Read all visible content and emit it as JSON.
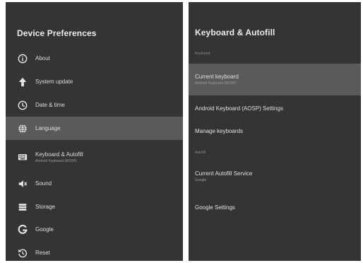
{
  "left": {
    "title": "Device Preferences",
    "items": [
      {
        "label": "About",
        "sub": "",
        "icon": "info-icon"
      },
      {
        "label": "System update",
        "sub": "",
        "icon": "arrow-up-icon"
      },
      {
        "label": "Date & time",
        "sub": "",
        "icon": "clock-icon"
      },
      {
        "label": "Language",
        "sub": "",
        "icon": "globe-icon",
        "selected": true
      },
      {
        "label": "Keyboard & Autofill",
        "sub": "Android Keyboard (AOSP)",
        "icon": "keyboard-icon"
      },
      {
        "label": "Sound",
        "sub": "",
        "icon": "speaker-icon"
      },
      {
        "label": "Storage",
        "sub": "",
        "icon": "storage-icon"
      },
      {
        "label": "Google",
        "sub": "",
        "icon": "google-icon"
      },
      {
        "label": "Reset",
        "sub": "",
        "icon": "reset-icon"
      }
    ]
  },
  "right": {
    "title": "Keyboard & Autofill",
    "section_keyboard": "Keyboard",
    "current_keyboard": {
      "label": "Current keyboard",
      "sub": "Android Keyboard (AOSP)"
    },
    "aosp_settings": {
      "label": "Android Keyboard (AOSP) Settings"
    },
    "manage_keyboards": {
      "label": "Manage keyboards"
    },
    "section_autofill": "Autofill",
    "autofill_service": {
      "label": "Current Autofill Service",
      "sub": "Google"
    },
    "google_settings": {
      "label": "Google Settings"
    }
  },
  "colors": {
    "panel_bg": "#343434",
    "selected_bg": "#5a5a5a",
    "page_bg": "#ffffff"
  }
}
